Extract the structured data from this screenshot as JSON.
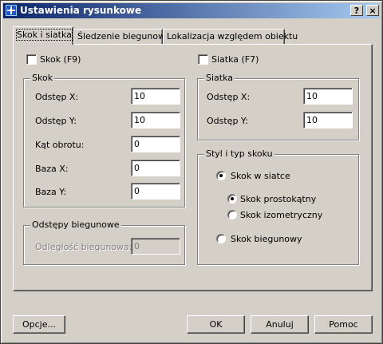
{
  "window": {
    "title": "Ustawienia rysunkowe",
    "help_glyph": "?",
    "close_glyph": "×"
  },
  "tabs": [
    {
      "label": "Skok i siatka",
      "active": true
    },
    {
      "label": "Śledzenie biegunowe",
      "active": false
    },
    {
      "label": "Lokalizacja względem obiektu",
      "active": false
    }
  ],
  "snap_toggle": {
    "label": "Skok (F9)",
    "checked": false
  },
  "grid_toggle": {
    "label": "Siatka (F7)",
    "checked": false
  },
  "snap_group": {
    "title": "Skok",
    "fields": [
      {
        "label": "Odstęp X:",
        "value": "10"
      },
      {
        "label": "Odstęp Y:",
        "value": "10"
      },
      {
        "label": "Kąt obrotu:",
        "value": "0"
      },
      {
        "label": "Baza X:",
        "value": "0"
      },
      {
        "label": "Baza Y:",
        "value": "0"
      }
    ]
  },
  "polar_group": {
    "title": "Odstępy biegunowe",
    "label": "Odległość biegunowa:",
    "value": "0"
  },
  "grid_group": {
    "title": "Siatka",
    "fields": [
      {
        "label": "Odstęp X:",
        "value": "10"
      },
      {
        "label": "Odstęp Y:",
        "value": "10"
      }
    ]
  },
  "style_group": {
    "title": "Styl i typ skoku",
    "grid_snap": {
      "label": "Skok w siatce",
      "selected": true
    },
    "rectangular": {
      "label": "Skok prostokątny",
      "selected": true
    },
    "isometric": {
      "label": "Skok izometryczny",
      "selected": false
    },
    "polar": {
      "label": "Skok biegunowy",
      "selected": false
    }
  },
  "buttons": {
    "options": "Opcje...",
    "ok": "OK",
    "cancel": "Anuluj",
    "help": "Pomoc"
  }
}
